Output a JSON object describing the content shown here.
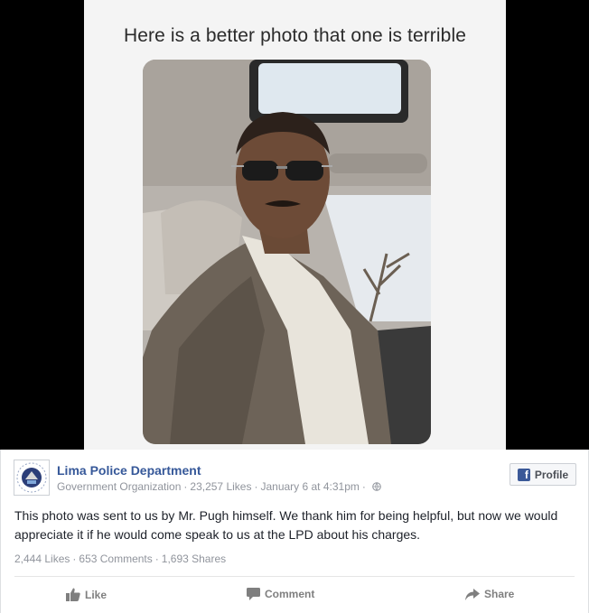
{
  "message": {
    "text": "Here is a better photo that one is terrible"
  },
  "post": {
    "page_name": "Lima Police Department",
    "category": "Government Organization",
    "likes": "23,257 Likes",
    "date": "January 6 at 4:31pm",
    "profile_button_label": "Profile",
    "body": "This photo was sent to us by Mr. Pugh himself. We thank him for being helpful, but now we would appreciate it if he would come speak to us at the LPD about his charges.",
    "stats": {
      "likes": "2,444 Likes",
      "comments": "653 Comments",
      "shares": "1,693 Shares"
    },
    "actions": {
      "like": "Like",
      "comment": "Comment",
      "share": "Share"
    }
  },
  "colors": {
    "link_blue": "#365899",
    "meta_gray": "#90949c",
    "fb_blue": "#3b5998"
  },
  "icons": [
    "globe-icon",
    "facebook-icon",
    "like-icon",
    "comment-icon",
    "share-icon"
  ]
}
